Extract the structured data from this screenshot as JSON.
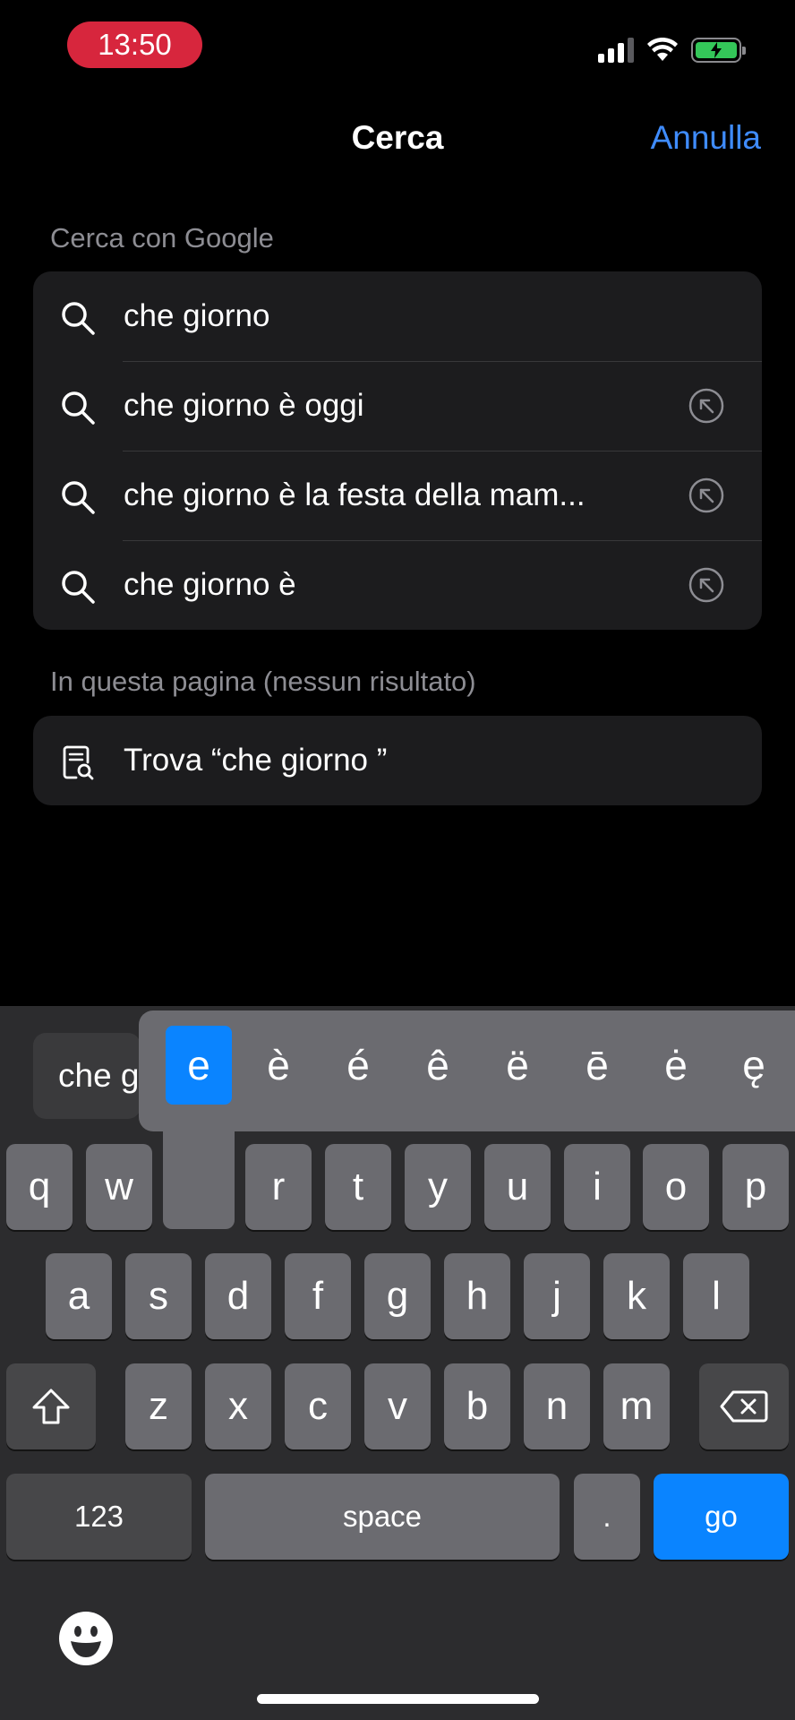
{
  "status_bar": {
    "time": "13:50"
  },
  "nav": {
    "title": "Cerca",
    "cancel": "Annulla"
  },
  "google_section": {
    "label": "Cerca con Google",
    "suggestions": [
      {
        "text": "che giorno"
      },
      {
        "text": "che giorno è oggi"
      },
      {
        "text": "che giorno è la festa della mam..."
      },
      {
        "text": "che giorno è"
      }
    ]
  },
  "page_section": {
    "label": "In questa pagina (nessun risultato)",
    "find_text": "Trova “che giorno ”"
  },
  "keyboard": {
    "suggestion_partial": "che g",
    "accent_options": [
      "e",
      "è",
      "é",
      "ê",
      "ë",
      "ē",
      "ė",
      "ę"
    ],
    "row1": [
      "q",
      "w",
      "r",
      "t",
      "y",
      "u",
      "i",
      "o",
      "p"
    ],
    "row2": [
      "a",
      "s",
      "d",
      "f",
      "g",
      "h",
      "j",
      "k",
      "l"
    ],
    "row3": [
      "z",
      "x",
      "c",
      "v",
      "b",
      "n",
      "m"
    ],
    "numbers_label": "123",
    "space_label": "space",
    "period_label": ".",
    "go_label": "go"
  },
  "colors": {
    "accent": "#0a84ff",
    "link": "#3f8cff",
    "time_pill": "#d7263d",
    "battery": "#34c759"
  }
}
